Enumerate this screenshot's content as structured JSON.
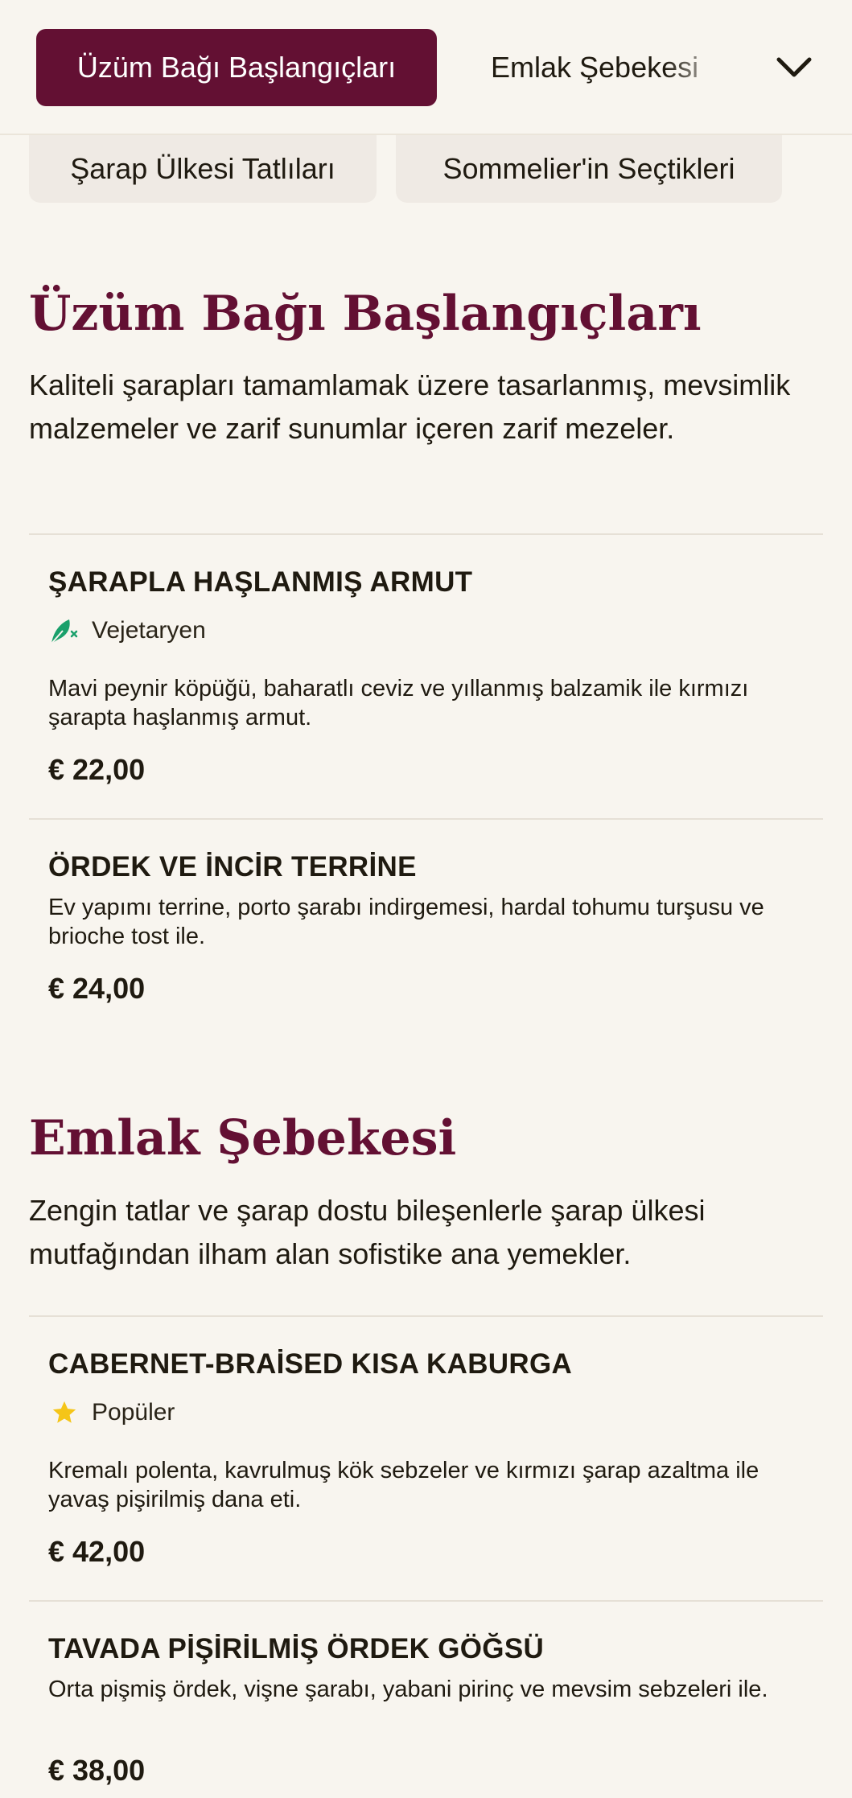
{
  "nav": {
    "active_category": "Üzüm Bağı Başlangıçları",
    "next_category": "Emlak Şebekesi",
    "chips": [
      "Şarap Ülkesi Tatlıları",
      "Sommelier'in Seçtikleri"
    ]
  },
  "sections": [
    {
      "title": "Üzüm Bağı Başlangıçları",
      "description": "Kaliteli şarapları tamamlamak üzere tasarlanmış, mevsimlik malzemeler ve zarif sunumlar içeren zarif mezeler.",
      "items": [
        {
          "name": "ŞARAPLA HAŞLANMIŞ ARMUT",
          "tag": "Vejetaryen",
          "tag_icon": "vegetarian-leaf-icon",
          "description": "Mavi peynir köpüğü, baharatlı ceviz ve yıllanmış balzamik ile kırmızı şarapta haşlanmış armut.",
          "price": "€ 22,00"
        },
        {
          "name": "ÖRDEK VE İNCİR TERRİNE",
          "description": "Ev yapımı terrine, porto şarabı indirgemesi, hardal tohumu turşusu ve brioche tost ile.",
          "price": "€ 24,00"
        }
      ]
    },
    {
      "title": "Emlak Şebekesi",
      "description": "Zengin tatlar ve şarap dostu bileşenlerle şarap ülkesi mutfağından ilham alan sofistike ana yemekler.",
      "items": [
        {
          "name": "CABERNET-BRAİSED KISA KABURGA",
          "tag": "Popüler",
          "tag_icon": "star-icon",
          "description": "Kremalı polenta, kavrulmuş kök sebzeler ve kırmızı şarap azaltma ile yavaş pişirilmiş dana eti.",
          "price": "€ 42,00"
        },
        {
          "name": "TAVADA PİŞİRİLMİŞ ÖRDEK GÖĞSÜ",
          "description": "Orta pişmiş ördek, vişne şarabı, yabani pirinç ve mevsim sebzeleri ile.",
          "price": "€ 38,00"
        }
      ]
    }
  ],
  "colors": {
    "accent": "#631033",
    "background": "#f8f5ef",
    "chip": "#efeae4",
    "leaf": "#1aa06b",
    "star": "#f5c518"
  }
}
